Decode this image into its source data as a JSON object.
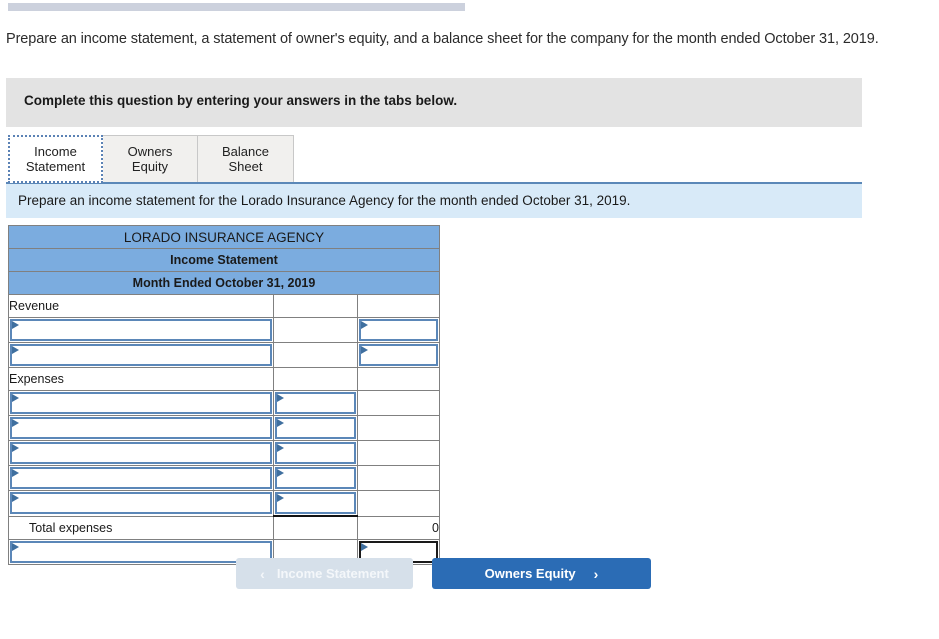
{
  "topbar": {
    "name": "progress-bar"
  },
  "question": {
    "text": "Prepare an income statement, a statement of owner's equity, and a balance sheet for the company for the month ended October 31, 2019."
  },
  "instruction": {
    "text": "Complete this question by entering your answers in the tabs below."
  },
  "tabs": [
    {
      "label": "Income\nStatement",
      "active": true
    },
    {
      "label": "Owners Equity",
      "active": false
    },
    {
      "label": "Balance Sheet",
      "active": false
    }
  ],
  "subbanner": {
    "text": "Prepare an income statement for the Lorado Insurance Agency for the month ended October 31, 2019."
  },
  "sheet": {
    "header": [
      "LORADO INSURANCE AGENCY",
      "Income Statement",
      "Month Ended October 31, 2019"
    ],
    "rows": [
      {
        "type": "label",
        "label": "Revenue",
        "indent": false,
        "col2": "",
        "col3": ""
      },
      {
        "type": "input",
        "fields": [
          "desc",
          "",
          "amount"
        ]
      },
      {
        "type": "input",
        "fields": [
          "desc",
          "",
          "amount"
        ]
      },
      {
        "type": "label",
        "label": "Expenses",
        "indent": false,
        "col2": "",
        "col3": ""
      },
      {
        "type": "input",
        "fields": [
          "desc",
          "amount",
          ""
        ]
      },
      {
        "type": "input",
        "fields": [
          "desc",
          "amount",
          ""
        ]
      },
      {
        "type": "input",
        "fields": [
          "desc",
          "amount",
          ""
        ]
      },
      {
        "type": "input",
        "fields": [
          "desc",
          "amount",
          ""
        ]
      },
      {
        "type": "input",
        "fields": [
          "desc",
          "amount",
          ""
        ],
        "underline_col2": true
      },
      {
        "type": "label",
        "label": "Total expenses",
        "indent": true,
        "col2": "",
        "col3": "0"
      },
      {
        "type": "input",
        "fields": [
          "desc",
          "",
          "amount_dark"
        ]
      }
    ]
  },
  "nav": {
    "prev_label": "Income Statement",
    "prev_chevron": "‹",
    "next_label": "Owners Equity",
    "next_chevron": "›"
  },
  "colors": {
    "header_blue": "#7bacdf",
    "banner_blue": "#d8eaf8",
    "instruction_gray": "#e3e3e3",
    "field_border": "#5b87b8",
    "button_blue": "#2b6cb5",
    "button_disabled": "#d6e0ea"
  }
}
